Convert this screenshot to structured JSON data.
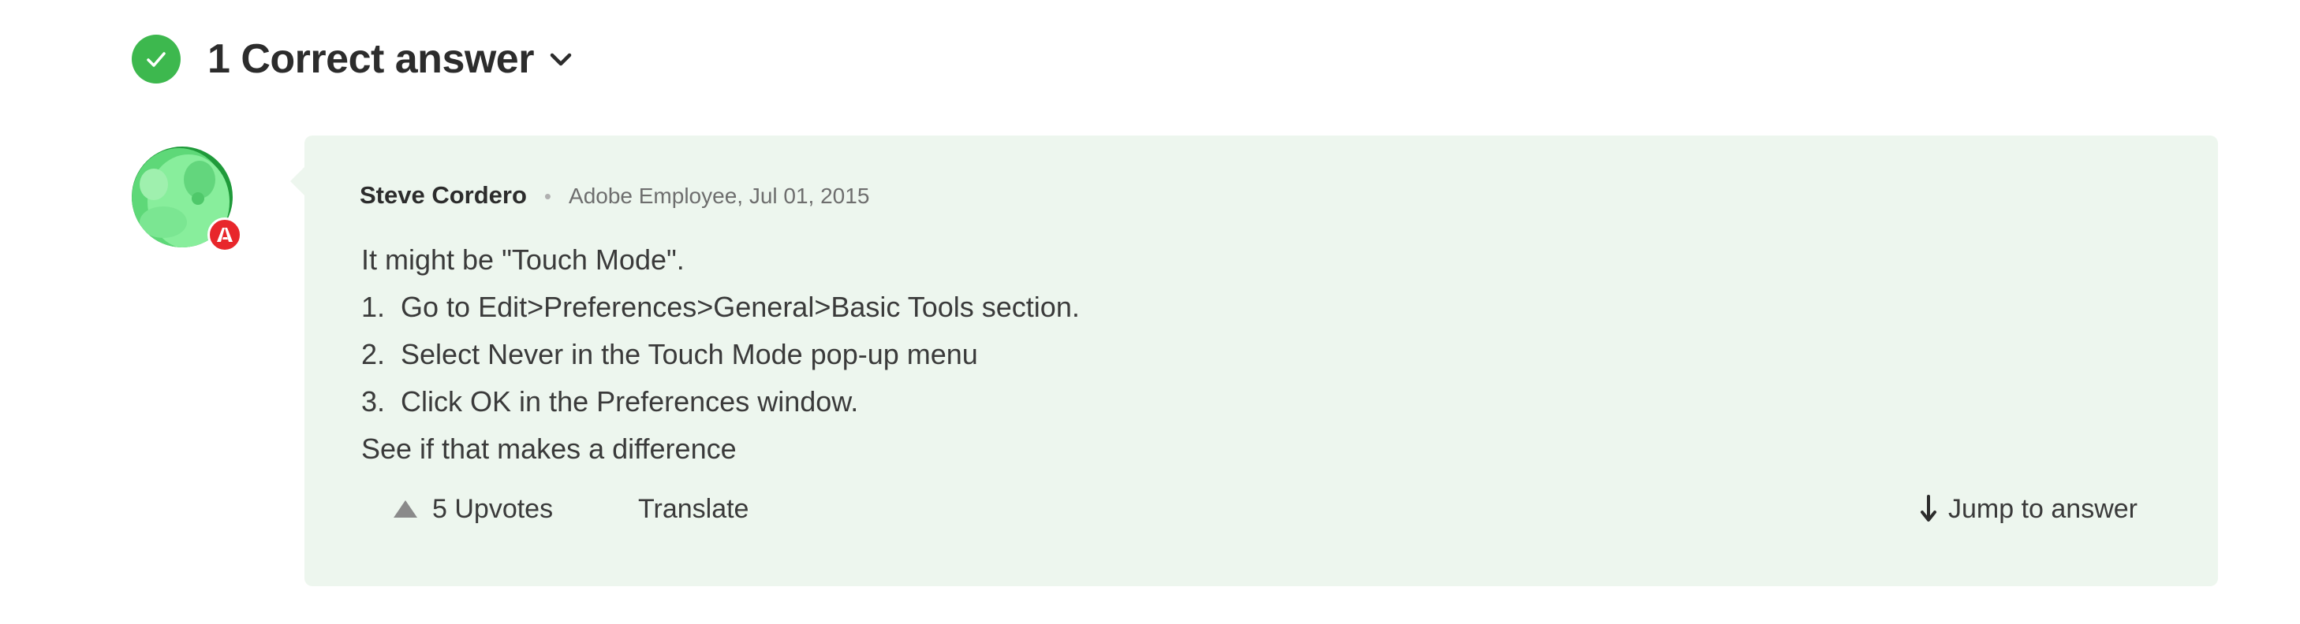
{
  "header": {
    "title": "1 Correct answer"
  },
  "post": {
    "author": "Steve Cordero",
    "separator": "•",
    "role_date": "Adobe Employee, Jul 01, 2015",
    "lines": [
      "It might be \"Touch Mode\".",
      "1.  Go to Edit>Preferences>General>Basic Tools section.",
      "2.  Select Never in the Touch Mode pop-up menu",
      "3.  Click OK in the Preferences window.",
      "See if that makes a difference"
    ]
  },
  "actions": {
    "upvotes_label": "5 Upvotes",
    "upvote_count": 5,
    "translate_label": "Translate",
    "jump_label": "Jump to answer"
  },
  "icons": {
    "check": "check-circle-icon",
    "chevron": "chevron-down-icon",
    "upvote": "triangle-up-icon",
    "jump": "arrow-down-icon",
    "badge": "adobe-badge-icon"
  },
  "colors": {
    "accent_green": "#3db84e",
    "card_background": "#edf6ee",
    "badge_red": "#e8262b",
    "avatar_green": "#6fe08a"
  }
}
